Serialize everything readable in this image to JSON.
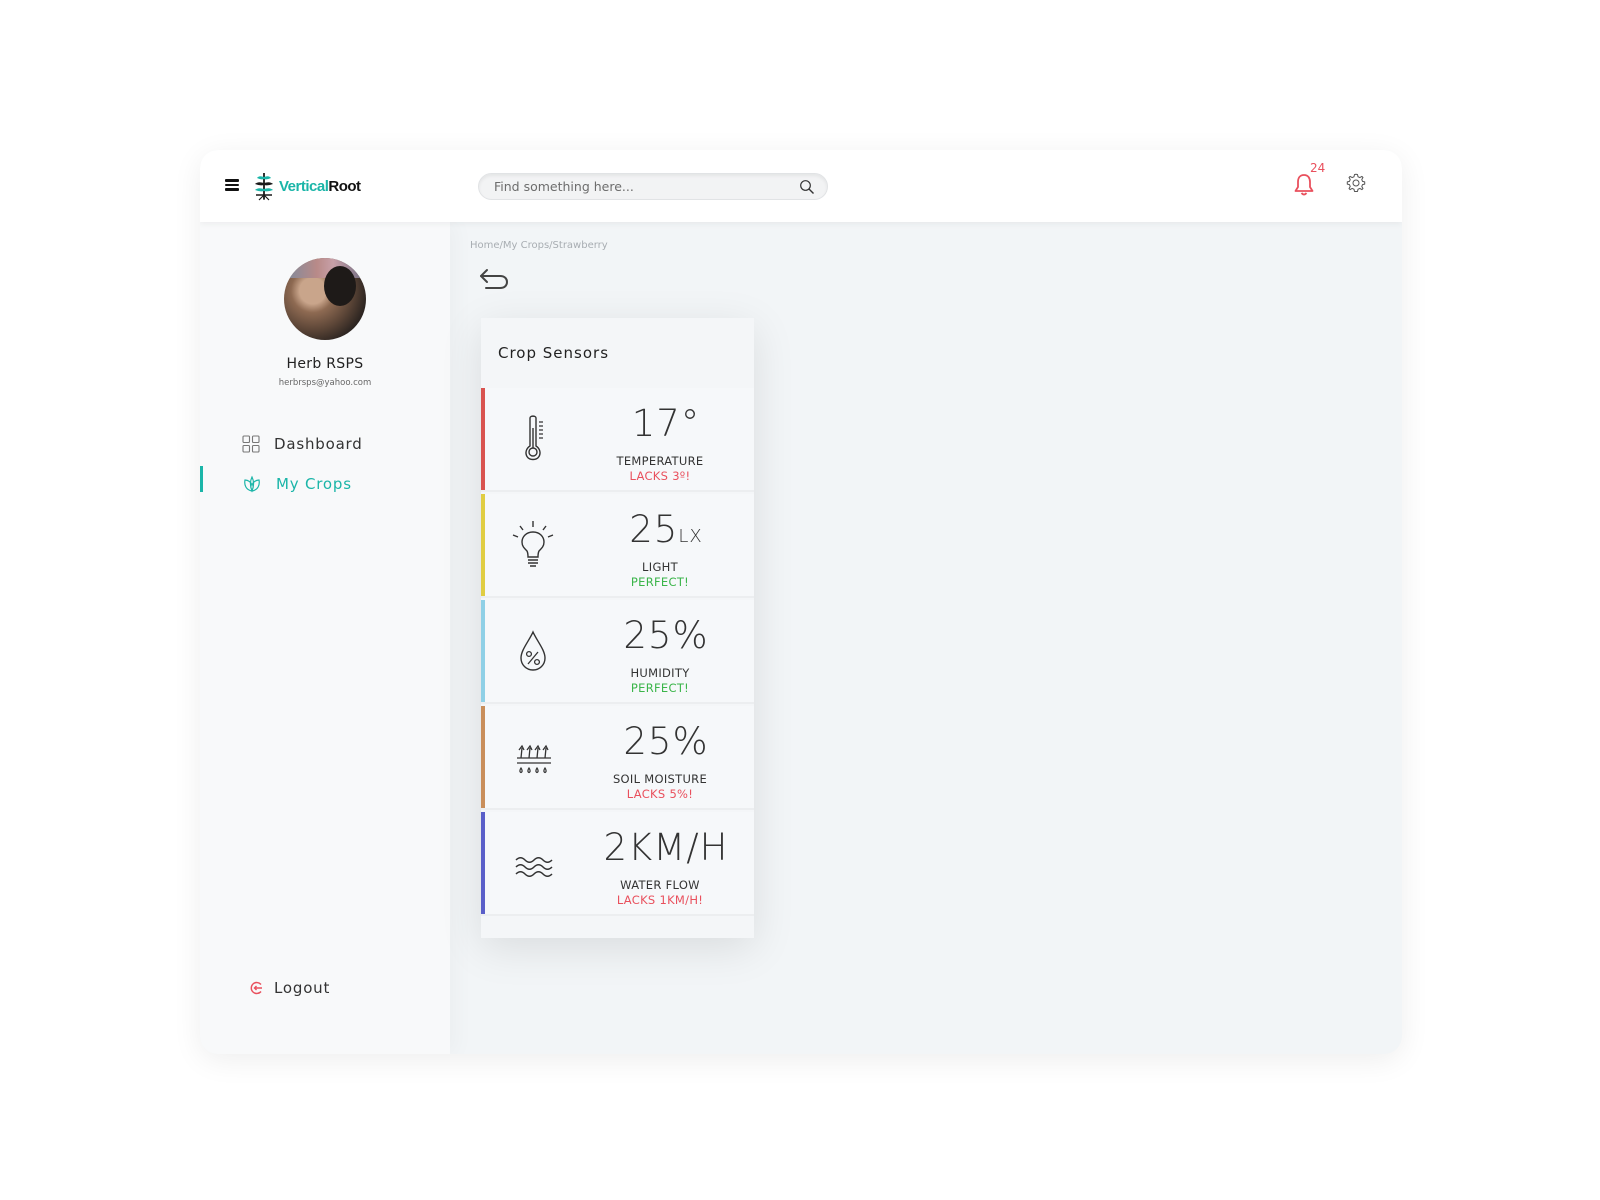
{
  "header": {
    "logo": {
      "part1": "Vertical",
      "part2": "Root"
    },
    "search": {
      "placeholder": "Find something here..."
    },
    "notifications": {
      "count": "24",
      "color": "#e9505d"
    },
    "accent_color": "#1ab5a8"
  },
  "sidebar": {
    "user": {
      "name": "Herb RSPS",
      "email": "herbrsps@yahoo.com"
    },
    "items": [
      {
        "label": "Dashboard",
        "icon": "grid-icon",
        "active": false
      },
      {
        "label": "My Crops",
        "icon": "leaf-icon",
        "active": true
      }
    ],
    "logout": {
      "label": "Logout",
      "icon": "logout-icon"
    }
  },
  "main": {
    "breadcrumb": "Home/My Crops/Strawberry",
    "card": {
      "title": "Crop Sensors",
      "sensors": [
        {
          "value": "17°",
          "unit": "",
          "label": "TEMPERATURE",
          "status": "LACKS 3º!",
          "status_type": "bad",
          "color": "#d9534f",
          "icon": "thermometer-icon"
        },
        {
          "value": "25",
          "unit": "LX",
          "label": "LIGHT",
          "status": "PERFECT!",
          "status_type": "good",
          "color": "#e0cd42",
          "icon": "light-bulb-icon"
        },
        {
          "value": "25%",
          "unit": "",
          "label": "HUMIDITY",
          "status": "PERFECT!",
          "status_type": "good",
          "color": "#8fd0e6",
          "icon": "humidity-drop-icon"
        },
        {
          "value": "25%",
          "unit": "",
          "label": "SOIL MOISTURE",
          "status": "LACKS 5%!",
          "status_type": "bad",
          "color": "#c98e5a",
          "icon": "soil-moisture-icon"
        },
        {
          "value": "2KM/H",
          "unit": "",
          "label": "WATER FLOW",
          "status": "LACKS 1KM/H!",
          "status_type": "bad",
          "color": "#5a5fc9",
          "icon": "water-waves-icon"
        }
      ]
    }
  },
  "status_colors": {
    "good": "#3bb54a",
    "bad": "#e9505d"
  }
}
